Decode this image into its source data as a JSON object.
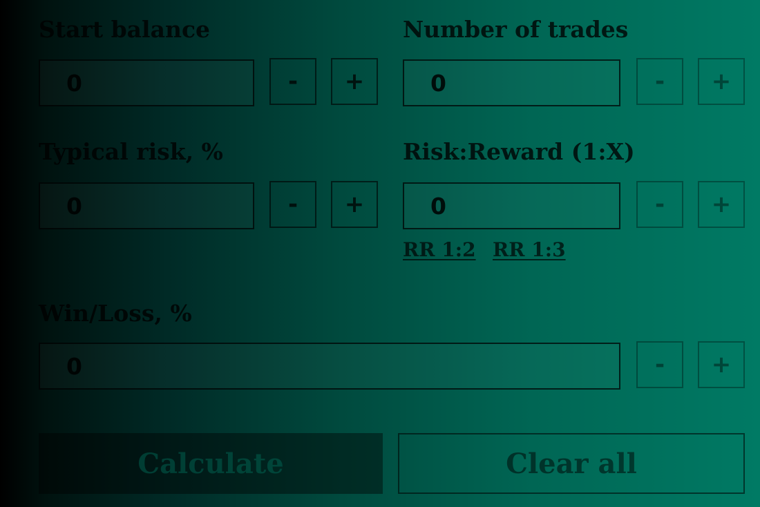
{
  "start_balance": {
    "label": "Start balance",
    "value": "0",
    "minus": "-",
    "plus": "+"
  },
  "number_of_trades": {
    "label": "Number of trades",
    "value": "0",
    "minus": "-",
    "plus": "+"
  },
  "typical_risk": {
    "label": "Typical risk, %",
    "value": "0",
    "minus": "-",
    "plus": "+"
  },
  "risk_reward": {
    "label": "Risk:Reward (1:X)",
    "value": "0",
    "minus": "-",
    "plus": "+",
    "presets": [
      "RR 1:2",
      "RR 1:3"
    ]
  },
  "win_loss": {
    "label": "Win/Loss, %",
    "value": "0",
    "minus": "-",
    "plus": "+"
  },
  "actions": {
    "calculate": "Calculate",
    "clear_all": "Clear all"
  },
  "colors": {
    "gradient_start": "#000000",
    "gradient_end": "#007a64"
  }
}
